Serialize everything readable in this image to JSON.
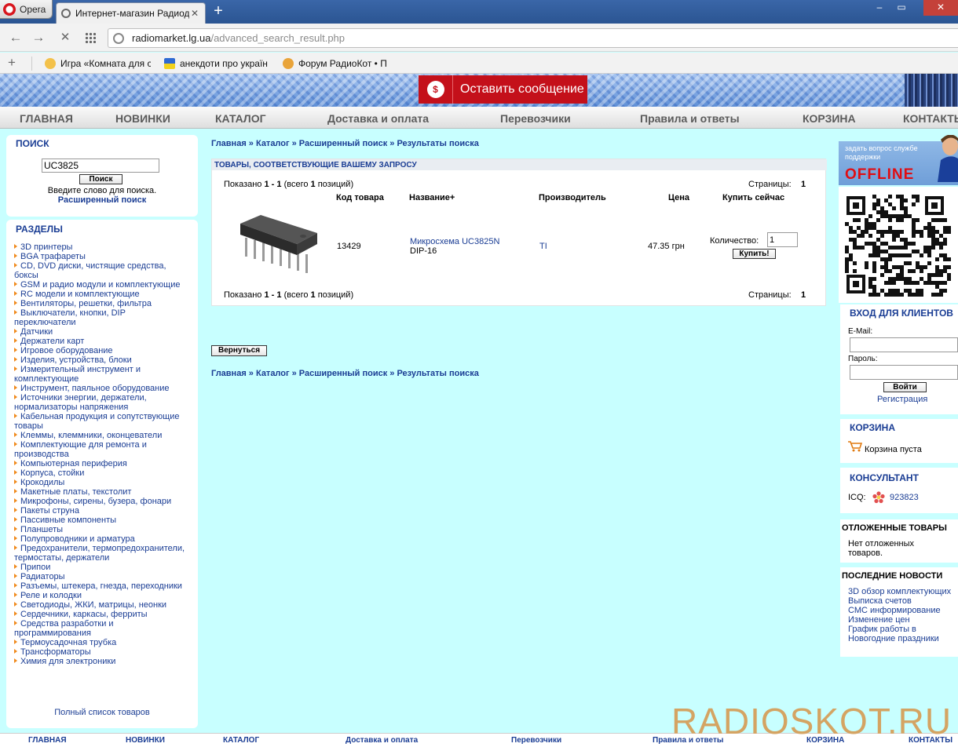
{
  "browser": {
    "opera_label": "Opera",
    "tab_title": "Интернет-магазин Радиод",
    "url_host": "radiomarket.lg.ua",
    "url_path": "/advanced_search_result.php",
    "bookmarks": [
      "Игра «Комната для с",
      "анекдоти про україн",
      "Форум РадиоКот • П"
    ]
  },
  "header": {
    "leave_message": "Оставить сообщение"
  },
  "topnav": [
    "ГЛАВНАЯ",
    "НОВИНКИ",
    "КАТАЛОГ",
    "Доставка и оплата",
    "Перевозчики",
    "Правила и ответы",
    "КОРЗИНА",
    "КОНТАКТЫ"
  ],
  "search": {
    "title": "ПОИСК",
    "value": "UC3825",
    "button": "Поиск",
    "hint": "Введите слово для поиска.",
    "advanced": "Расширенный поиск"
  },
  "categories": {
    "title": "РАЗДЕЛЫ",
    "items": [
      "3D принтеры",
      "BGA трафареты",
      "CD, DVD диски, чистящие средства, боксы",
      "GSM и радио модули и комплектующие",
      "RC модели и комплектующие",
      "Вентиляторы, решетки, фильтра",
      "Выключатели, кнопки, DIP переключатели",
      "Датчики",
      "Держатели карт",
      "Игровое оборудование",
      "Изделия, устройства, блоки",
      "Измерительный инструмент и комплектующие",
      "Инструмент, паяльное оборудование",
      "Источники энергии, держатели, нормализаторы напряжения",
      "Кабельная продукция и сопутствующие товары",
      "Клеммы, клеммники, оконцеватели",
      "Комплектующие для ремонта и производства",
      "Компьютерная периферия",
      "Корпуса, стойки",
      "Крокодилы",
      "Макетные платы, текстолит",
      "Микрофоны, сирены, бузера, фонари",
      "Пакеты струна",
      "Пассивные компоненты",
      "Планшеты",
      "Полупроводники и арматура",
      "Предохранители, термопредохранители, термостаты, держатели",
      "Припои",
      "Радиаторы",
      "Разъемы, штекера, гнезда, переходники",
      "Реле и колодки",
      "Светодиоды, ЖКИ, матрицы, неонки",
      "Сердечники, каркасы, ферриты",
      "Средства разработки и программирования",
      "Термоусадочная трубка",
      "Трансформаторы",
      "Химия для электроники"
    ],
    "full_list": "Полный список товаров"
  },
  "breadcrumbs": "Главная » Каталог » Расширенный поиск » Результаты поиска",
  "results": {
    "heading": "ТОВАРЫ, СООТВЕТСТВУЮЩИЕ ВАШЕМУ ЗАПРОСУ",
    "shown_prefix": "Показано",
    "shown_range": "1 - 1",
    "shown_total_pre": "(всего",
    "shown_total": "1",
    "shown_total_post": "позиций)",
    "pages_label": "Страницы:",
    "pages_value": "1",
    "columns": [
      "Код товара",
      "Название+",
      "Производитель",
      "Цена",
      "Купить сейчас"
    ],
    "row": {
      "code": "13429",
      "name_link": "Микросхема UC3825N",
      "name_sub": "DIP-16",
      "maker": "TI",
      "price": "47.35 грн",
      "qty_label": "Количество:",
      "qty_value": "1",
      "buy": "Купить!"
    },
    "back": "Вернуться"
  },
  "support": {
    "question": "задать вопрос службе поддержки",
    "status": "OFFLINE"
  },
  "login": {
    "title": "ВХОД ДЛЯ КЛИЕНТОВ",
    "email_label": "E-Mail:",
    "password_label": "Пароль:",
    "button": "Войти",
    "register": "Регистрация"
  },
  "cart": {
    "title": "КОРЗИНА",
    "status": "Корзина пуста"
  },
  "consultant": {
    "title": "КОНСУЛЬТАНТ",
    "icq_label": "ICQ:",
    "icq_number": "923823"
  },
  "deferred": {
    "title": "ОТЛОЖЕННЫЕ ТОВАРЫ",
    "text": "Нет отложенных товаров."
  },
  "news": {
    "title": "ПОСЛЕДНИЕ НОВОСТИ",
    "items": [
      "3D обзор комплектующих",
      "Выписка счетов",
      "СМС информирование",
      "Изменение цен",
      "График работы в Новогодние праздники"
    ]
  },
  "footnav": [
    "ГЛАВНАЯ",
    "НОВИНКИ",
    "КАТАЛОГ",
    "Доставка и оплата",
    "Перевозчики",
    "Правила и ответы",
    "КОРЗИНА",
    "КОНТАКТЫ"
  ],
  "watermark": "RADIOSKOT.RU"
}
